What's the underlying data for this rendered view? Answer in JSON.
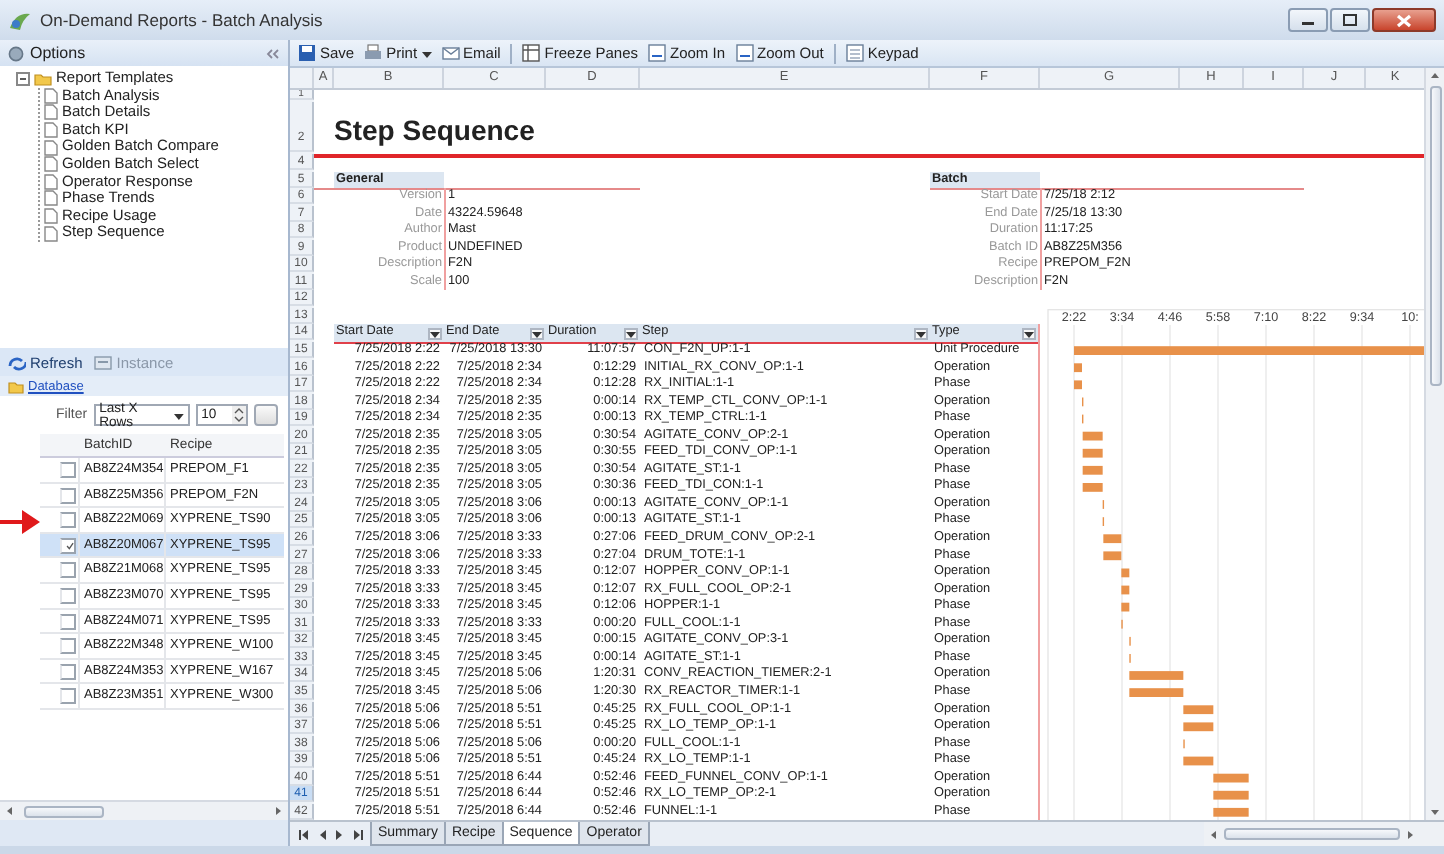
{
  "window": {
    "title": "On-Demand Reports - Batch Analysis"
  },
  "options_panel": {
    "title": "Options",
    "tree": [
      {
        "label": "Report Templates",
        "expanded": true,
        "children": [
          {
            "label": "Batch Analysis"
          },
          {
            "label": "Batch Details"
          },
          {
            "label": "Batch KPI"
          },
          {
            "label": "Golden Batch Compare"
          },
          {
            "label": "Golden Batch Select"
          },
          {
            "label": "Operator Response"
          },
          {
            "label": "Phase Trends"
          },
          {
            "label": "Recipe Usage"
          },
          {
            "label": "Step Sequence"
          }
        ]
      }
    ]
  },
  "lower_panel": {
    "actions": [
      {
        "label": "Refresh",
        "disabled": false
      },
      {
        "label": "Instance",
        "disabled": true
      }
    ],
    "source": "Database",
    "filter": {
      "label": "Filter",
      "mode": "Last X Rows",
      "count": "10"
    },
    "columns": [
      "BatchID",
      "Recipe"
    ],
    "batches": [
      {
        "id": "AB8Z24M354",
        "recipe": "PREPOM_F1",
        "checked": false,
        "selected": false
      },
      {
        "id": "AB8Z25M356",
        "recipe": "PREPOM_F2N",
        "checked": false,
        "selected": false
      },
      {
        "id": "AB8Z22M069",
        "recipe": "XYPRENE_TS90",
        "checked": false,
        "selected": false
      },
      {
        "id": "AB8Z20M067",
        "recipe": "XYPRENE_TS95",
        "checked": true,
        "selected": true
      },
      {
        "id": "AB8Z21M068",
        "recipe": "XYPRENE_TS95",
        "checked": false,
        "selected": false
      },
      {
        "id": "AB8Z23M070",
        "recipe": "XYPRENE_TS95",
        "checked": false,
        "selected": false
      },
      {
        "id": "AB8Z24M071",
        "recipe": "XYPRENE_TS95",
        "checked": false,
        "selected": false
      },
      {
        "id": "AB8Z22M348",
        "recipe": "XYPRENE_W100",
        "checked": false,
        "selected": false
      },
      {
        "id": "AB8Z24M353",
        "recipe": "XYPRENE_W167",
        "checked": false,
        "selected": false
      },
      {
        "id": "AB8Z23M351",
        "recipe": "XYPRENE_W300",
        "checked": false,
        "selected": false
      }
    ]
  },
  "toolbar": [
    {
      "label": "Save",
      "dropdown": false,
      "separator_before": false
    },
    {
      "label": "Print",
      "dropdown": true,
      "separator_before": false
    },
    {
      "label": "Email",
      "dropdown": false,
      "separator_before": false
    },
    {
      "label": "Freeze Panes",
      "dropdown": false,
      "separator_before": true
    },
    {
      "label": "Zoom In",
      "dropdown": false,
      "separator_before": false
    },
    {
      "label": "Zoom Out",
      "dropdown": false,
      "separator_before": false
    },
    {
      "label": "Keypad",
      "dropdown": false,
      "separator_before": true
    }
  ],
  "sheet": {
    "columns": [
      "A",
      "B",
      "C",
      "D",
      "E",
      "F",
      "G",
      "H",
      "I",
      "J",
      "K"
    ],
    "row_numbers": [
      {
        "label": "1",
        "selected": false
      },
      {
        "label": "2",
        "selected": false
      },
      {
        "label": "4",
        "selected": false
      },
      {
        "label": "5",
        "selected": false
      },
      {
        "label": "6",
        "selected": false
      },
      {
        "label": "7",
        "selected": false
      },
      {
        "label": "8",
        "selected": false
      },
      {
        "label": "9",
        "selected": false
      },
      {
        "label": "10",
        "selected": false
      },
      {
        "label": "11",
        "selected": false
      },
      {
        "label": "12",
        "selected": false
      },
      {
        "label": "13",
        "selected": false
      },
      {
        "label": "14",
        "selected": false
      },
      {
        "label": "15",
        "selected": false
      },
      {
        "label": "16",
        "selected": false
      },
      {
        "label": "17",
        "selected": false
      },
      {
        "label": "18",
        "selected": false
      },
      {
        "label": "19",
        "selected": false
      },
      {
        "label": "20",
        "selected": false
      },
      {
        "label": "21",
        "selected": false
      },
      {
        "label": "22",
        "selected": false
      },
      {
        "label": "23",
        "selected": false
      },
      {
        "label": "24",
        "selected": false
      },
      {
        "label": "25",
        "selected": false
      },
      {
        "label": "26",
        "selected": false
      },
      {
        "label": "27",
        "selected": false
      },
      {
        "label": "28",
        "selected": false
      },
      {
        "label": "29",
        "selected": false
      },
      {
        "label": "30",
        "selected": false
      },
      {
        "label": "31",
        "selected": false
      },
      {
        "label": "32",
        "selected": false
      },
      {
        "label": "33",
        "selected": false
      },
      {
        "label": "34",
        "selected": false
      },
      {
        "label": "35",
        "selected": false
      },
      {
        "label": "36",
        "selected": false
      },
      {
        "label": "37",
        "selected": false
      },
      {
        "label": "38",
        "selected": false
      },
      {
        "label": "39",
        "selected": false
      },
      {
        "label": "40",
        "selected": false
      },
      {
        "label": "41",
        "selected": true
      },
      {
        "label": "42",
        "selected": false
      }
    ],
    "title": "Step Sequence",
    "general": {
      "heading": "General",
      "fields": [
        {
          "label": "Version",
          "value": "1"
        },
        {
          "label": "Date",
          "value": "43224.59648"
        },
        {
          "label": "Author",
          "value": "Mast"
        },
        {
          "label": "Product",
          "value": "UNDEFINED"
        },
        {
          "label": "Description",
          "value": "F2N"
        },
        {
          "label": "Scale",
          "value": "100"
        }
      ]
    },
    "batch": {
      "heading": "Batch",
      "fields": [
        {
          "label": "Start Date",
          "value": "7/25/18 2:12"
        },
        {
          "label": "End Date",
          "value": "7/25/18 13:30"
        },
        {
          "label": "Duration",
          "value": "11:17:25"
        },
        {
          "label": "Batch ID",
          "value": "AB8Z25M356"
        },
        {
          "label": "Recipe",
          "value": "PREPOM_F2N"
        },
        {
          "label": "Description",
          "value": "F2N"
        }
      ]
    },
    "table": {
      "columns": [
        "Start Date",
        "End Date",
        "Duration",
        "Step",
        "Type"
      ],
      "rows": [
        [
          "7/25/2018 2:22",
          "7/25/2018 13:30",
          "11:07:57",
          "CON_F2N_UP:1-1",
          "Unit Procedure"
        ],
        [
          "7/25/2018 2:22",
          "7/25/2018 2:34",
          "0:12:29",
          "INITIAL_RX_CONV_OP:1-1",
          "Operation"
        ],
        [
          "7/25/2018 2:22",
          "7/25/2018 2:34",
          "0:12:28",
          "RX_INITIAL:1-1",
          "Phase"
        ],
        [
          "7/25/2018 2:34",
          "7/25/2018 2:35",
          "0:00:14",
          "RX_TEMP_CTL_CONV_OP:1-1",
          "Operation"
        ],
        [
          "7/25/2018 2:34",
          "7/25/2018 2:35",
          "0:00:13",
          "RX_TEMP_CTRL:1-1",
          "Phase"
        ],
        [
          "7/25/2018 2:35",
          "7/25/2018 3:05",
          "0:30:54",
          "AGITATE_CONV_OP:2-1",
          "Operation"
        ],
        [
          "7/25/2018 2:35",
          "7/25/2018 3:05",
          "0:30:55",
          "FEED_TDI_CONV_OP:1-1",
          "Operation"
        ],
        [
          "7/25/2018 2:35",
          "7/25/2018 3:05",
          "0:30:54",
          "AGITATE_ST:1-1",
          "Phase"
        ],
        [
          "7/25/2018 2:35",
          "7/25/2018 3:05",
          "0:30:36",
          "FEED_TDI_CON:1-1",
          "Phase"
        ],
        [
          "7/25/2018 3:05",
          "7/25/2018 3:06",
          "0:00:13",
          "AGITATE_CONV_OP:1-1",
          "Operation"
        ],
        [
          "7/25/2018 3:05",
          "7/25/2018 3:06",
          "0:00:13",
          "AGITATE_ST:1-1",
          "Phase"
        ],
        [
          "7/25/2018 3:06",
          "7/25/2018 3:33",
          "0:27:06",
          "FEED_DRUM_CONV_OP:2-1",
          "Operation"
        ],
        [
          "7/25/2018 3:06",
          "7/25/2018 3:33",
          "0:27:04",
          "DRUM_TOTE:1-1",
          "Phase"
        ],
        [
          "7/25/2018 3:33",
          "7/25/2018 3:45",
          "0:12:07",
          "HOPPER_CONV_OP:1-1",
          "Operation"
        ],
        [
          "7/25/2018 3:33",
          "7/25/2018 3:45",
          "0:12:07",
          "RX_FULL_COOL_OP:2-1",
          "Operation"
        ],
        [
          "7/25/2018 3:33",
          "7/25/2018 3:45",
          "0:12:06",
          "HOPPER:1-1",
          "Phase"
        ],
        [
          "7/25/2018 3:33",
          "7/25/2018 3:33",
          "0:00:20",
          "FULL_COOL:1-1",
          "Phase"
        ],
        [
          "7/25/2018 3:45",
          "7/25/2018 3:45",
          "0:00:15",
          "AGITATE_CONV_OP:3-1",
          "Operation"
        ],
        [
          "7/25/2018 3:45",
          "7/25/2018 3:45",
          "0:00:14",
          "AGITATE_ST:1-1",
          "Phase"
        ],
        [
          "7/25/2018 3:45",
          "7/25/2018 5:06",
          "1:20:31",
          "CONV_REACTION_TIEMER:2-1",
          "Operation"
        ],
        [
          "7/25/2018 3:45",
          "7/25/2018 5:06",
          "1:20:30",
          "RX_REACTOR_TIMER:1-1",
          "Phase"
        ],
        [
          "7/25/2018 5:06",
          "7/25/2018 5:51",
          "0:45:25",
          "RX_FULL_COOL_OP:1-1",
          "Operation"
        ],
        [
          "7/25/2018 5:06",
          "7/25/2018 5:51",
          "0:45:25",
          "RX_LO_TEMP_OP:1-1",
          "Operation"
        ],
        [
          "7/25/2018 5:06",
          "7/25/2018 5:06",
          "0:00:20",
          "FULL_COOL:1-1",
          "Phase"
        ],
        [
          "7/25/2018 5:06",
          "7/25/2018 5:51",
          "0:45:24",
          "RX_LO_TEMP:1-1",
          "Phase"
        ],
        [
          "7/25/2018 5:51",
          "7/25/2018 6:44",
          "0:52:46",
          "FEED_FUNNEL_CONV_OP:1-1",
          "Operation"
        ],
        [
          "7/25/2018 5:51",
          "7/25/2018 6:44",
          "0:52:46",
          "RX_LO_TEMP_OP:2-1",
          "Operation"
        ],
        [
          "7/25/2018 5:51",
          "7/25/2018 6:44",
          "0:52:46",
          "FUNNEL:1-1",
          "Phase"
        ]
      ]
    },
    "gantt": {
      "time_labels": [
        "2:22",
        "3:34",
        "4:46",
        "5:58",
        "7:10",
        "8:22",
        "9:34",
        "10:"
      ]
    }
  },
  "sheet_tabs": [
    {
      "label": "Summary",
      "selected": false
    },
    {
      "label": "Recipe",
      "selected": false
    },
    {
      "label": "Sequence",
      "selected": true
    },
    {
      "label": "Operator",
      "selected": false
    }
  ]
}
